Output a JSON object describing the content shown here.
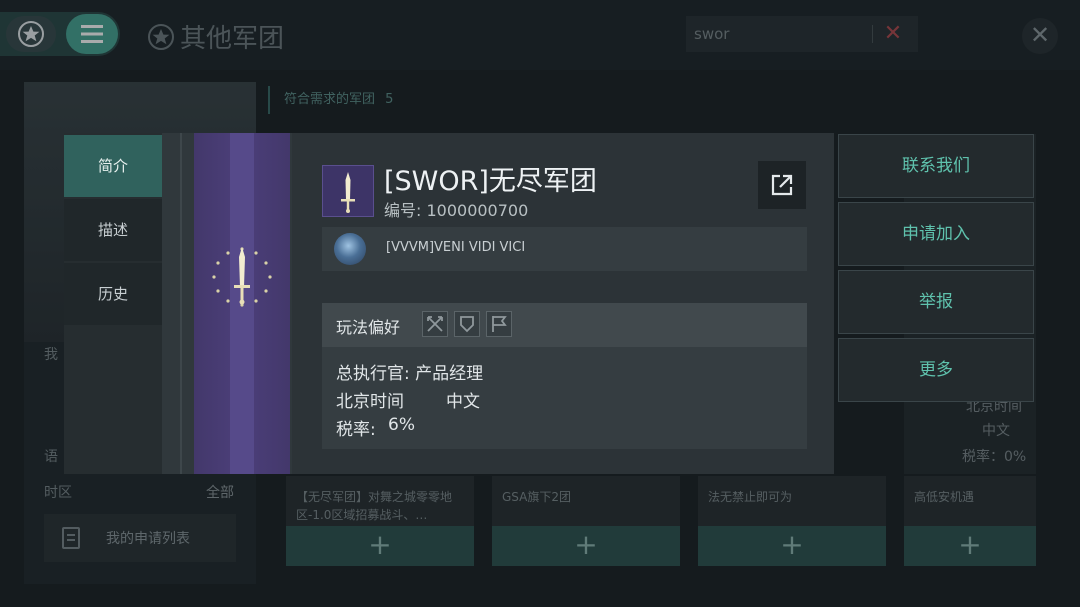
{
  "header": {
    "title": "其他军团",
    "search_value": "swor",
    "clear_icon": "✕",
    "close_icon": "✕"
  },
  "left_panel": {
    "me_label": "我",
    "lang_label": "语",
    "timezone_label": "时区",
    "timezone_value": "全部",
    "my_apply_label": "我的申请列表"
  },
  "results": {
    "header": "符合需求的军团",
    "count": "5",
    "cards": [
      {
        "desc": "【无尽军团】对舞之城零零地区-1.0区域招募战斗、…"
      },
      {
        "desc": "GSA旗下2团"
      },
      {
        "desc": "法无禁止即可为"
      },
      {
        "desc": "高低安机遇"
      }
    ],
    "add_label": "+",
    "bg_info": {
      "time_label": "北京时间",
      "lang": "中文",
      "tax": "税率：0%"
    }
  },
  "modal": {
    "tabs": [
      {
        "label": "简介",
        "active": true
      },
      {
        "label": "描述",
        "active": false
      },
      {
        "label": "历史",
        "active": false
      }
    ],
    "guild_name": "[SWOR]无尽军团",
    "guild_id": "编号: 1000000700",
    "alliance_name": "[VVVM]VENI VIDI VICI",
    "pref_label": "玩法偏好",
    "pref_icons": [
      "swords-icon",
      "shield-icon",
      "flag-icon"
    ],
    "details": {
      "ceo_label": "总执行官: 产品经理",
      "timezone_label": "北京时间",
      "timezone_value": "中文",
      "tax_label": "税率:",
      "tax_value": "6%"
    }
  },
  "actions": [
    {
      "label": "联系我们"
    },
    {
      "label": "申请加入"
    },
    {
      "label": "举报"
    },
    {
      "label": "更多"
    }
  ],
  "colors": {
    "accent": "#49a594",
    "action_text": "#5fc2ad",
    "banner": "#4c3f7a"
  }
}
